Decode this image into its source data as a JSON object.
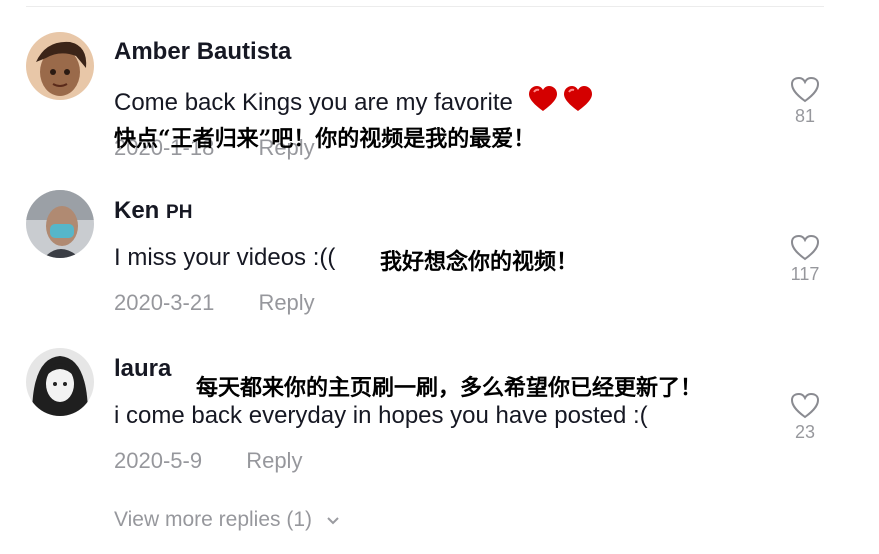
{
  "comments": [
    {
      "username": "Amber Bautista",
      "text": "Come back Kings you are my favorite",
      "emoji": "heart-emoji x2",
      "translation": "快点“王者归来”吧！你的视频是我的最爱！",
      "date": "2020-1-18",
      "reply_label": "Reply",
      "likes": "81"
    },
    {
      "username_main": "Ken",
      "username_suffix": "PH",
      "text": "I miss your videos :((",
      "translation": "我好想念你的视频！",
      "date": "2020-3-21",
      "reply_label": "Reply",
      "likes": "117"
    },
    {
      "username": "laura",
      "text": "i come back everyday in hopes you have posted :(",
      "translation": "每天都来你的主页刷一刷，多么希望你已经更新了！",
      "date": "2020-5-9",
      "reply_label": "Reply",
      "likes": "23"
    }
  ],
  "view_more": "View more replies (1)",
  "icons": {
    "like": "heart-outline-icon",
    "expand": "chevron-down-icon"
  },
  "colors": {
    "text": "#161823",
    "muted": "rgba(22,24,35,0.45)",
    "emoji_heart": "#d40000"
  }
}
